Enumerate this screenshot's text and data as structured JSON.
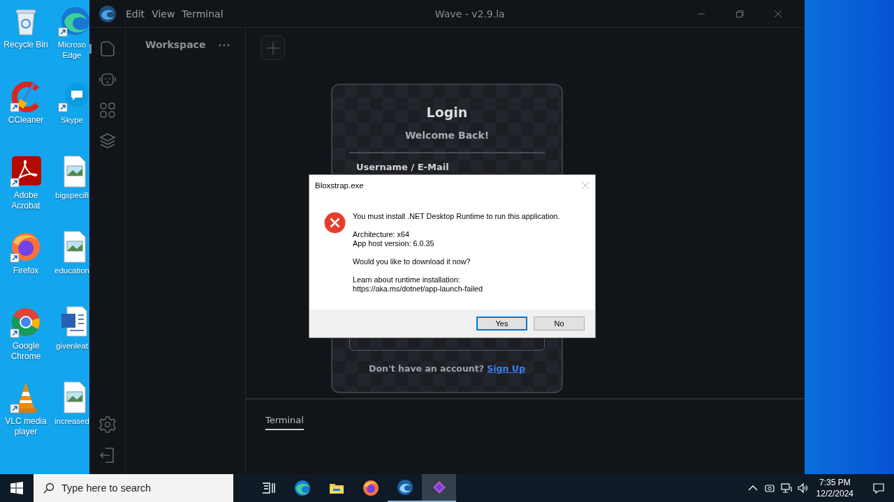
{
  "desktop": {
    "icons": [
      {
        "kind": "recycle",
        "label": "Recycle Bin",
        "shortcut": false
      },
      {
        "kind": "edge",
        "label": "Microso Edge",
        "shortcut": true
      },
      {
        "kind": "ccleaner",
        "label": "CCleaner",
        "shortcut": true
      },
      {
        "kind": "skype",
        "label": "Skype",
        "shortcut": true
      },
      {
        "kind": "acrobat",
        "label": "Adobe Acrobat",
        "shortcut": true
      },
      {
        "kind": "image",
        "label": "bigspecifi",
        "shortcut": false
      },
      {
        "kind": "firefox",
        "label": "Firefox",
        "shortcut": true
      },
      {
        "kind": "image",
        "label": "education",
        "shortcut": false
      },
      {
        "kind": "chrome",
        "label": "Google Chrome",
        "shortcut": true
      },
      {
        "kind": "word",
        "label": "givenleat",
        "shortcut": false
      },
      {
        "kind": "vlc",
        "label": "VLC media player",
        "shortcut": true
      },
      {
        "kind": "image",
        "label": "increased",
        "shortcut": false
      }
    ]
  },
  "window": {
    "title": "Wave - v2.9.la",
    "menu": [
      "Edit",
      "View",
      "Terminal"
    ],
    "activity": [
      {
        "kind": "folder",
        "selected": true
      },
      {
        "kind": "robot",
        "selected": false
      },
      {
        "kind": "apps",
        "selected": false
      },
      {
        "kind": "layers",
        "selected": false
      }
    ],
    "activity_bottom": [
      {
        "kind": "settings"
      },
      {
        "kind": "logout"
      }
    ],
    "workspace": {
      "title": "Workspace"
    },
    "login": {
      "title": "Login",
      "subtitle": "Welcome Back!",
      "field_label": "Username / E-Mail",
      "signup_prompt": "Don't have an account?",
      "signup_link": "Sign Up"
    },
    "panel_tabs": [
      {
        "label": "Terminal",
        "selected": true
      }
    ]
  },
  "dialog": {
    "title": "Bloxstrap.exe",
    "paragraphs": [
      {
        "lines": [
          "You must install .NET Desktop Runtime to run this application."
        ]
      },
      {
        "lines": [
          "Architecture: x64",
          "App host version: 6.0.35"
        ]
      },
      {
        "lines": [
          "Would you like to download it now?"
        ]
      },
      {
        "lines": [
          "Learn about runtime installation:",
          "https://aka.ms/dotnet/app-launch-failed"
        ]
      }
    ],
    "buttons": [
      {
        "label": "Yes",
        "default": true
      },
      {
        "label": "No",
        "default": false
      }
    ]
  },
  "taskbar": {
    "search": {
      "placeholder": "Type here to search"
    },
    "apps": [
      {
        "kind": "taskview",
        "running": false,
        "selected": false
      },
      {
        "kind": "edge",
        "running": false,
        "selected": false
      },
      {
        "kind": "explorer",
        "running": false,
        "selected": false
      },
      {
        "kind": "firefox",
        "running": false,
        "selected": false
      },
      {
        "kind": "wave",
        "running": true,
        "selected": false
      },
      {
        "kind": "bloxstrap",
        "running": true,
        "selected": true
      }
    ],
    "time": "7:35 PM",
    "date": "12/2/2024"
  }
}
